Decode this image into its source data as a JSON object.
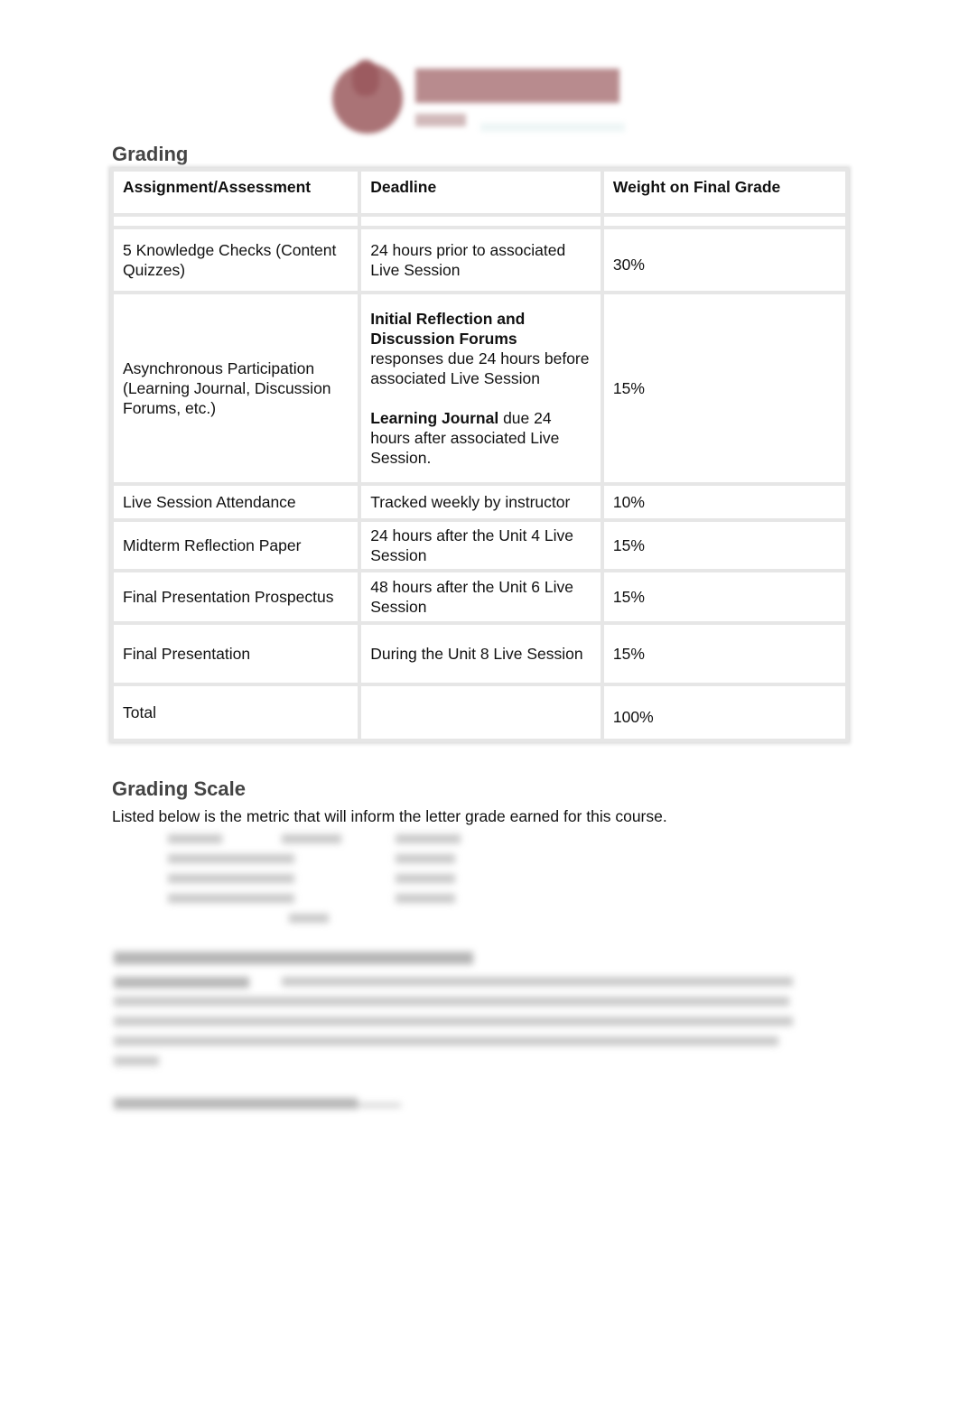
{
  "logo": {
    "name": "Morehouse logo",
    "brand_color": "#9b5a5e"
  },
  "grading": {
    "title": "Grading",
    "headers": [
      "Assignment/Assessment",
      "Deadline",
      "Weight on Final Grade"
    ],
    "rows": [
      {
        "assignment": "5 Knowledge Checks (Content Quizzes)",
        "deadline": "24 hours prior to associated Live Session",
        "weight": "30%"
      },
      {
        "assignment": "Asynchronous Participation (Learning Journal, Discussion Forums, etc.)",
        "deadline_parts": {
          "bold1": "Initial Reflection and Discussion Forums",
          "text1": "responses due 24 hours before associated Live Session",
          "bold2": "Learning Journal",
          "text2": "due 24 hours after associated Live Session."
        },
        "weight": "15%"
      },
      {
        "assignment": "Live Session Attendance",
        "deadline": "Tracked weekly by instructor",
        "weight": "10%"
      },
      {
        "assignment": "Midterm Reflection Paper",
        "deadline": "24 hours after the Unit 4 Live Session",
        "weight": "15%"
      },
      {
        "assignment": "Final Presentation Prospectus",
        "deadline": "48 hours after the Unit 6 Live Session",
        "weight": "15%"
      },
      {
        "assignment": "Final Presentation",
        "deadline": "During the Unit 8 Live Session",
        "weight": "15%"
      },
      {
        "assignment": "Total",
        "deadline": "",
        "weight": "100%"
      }
    ]
  },
  "grading_scale": {
    "title": "Grading Scale",
    "intro": "Listed below is the metric that will inform the letter grade earned for this course."
  }
}
